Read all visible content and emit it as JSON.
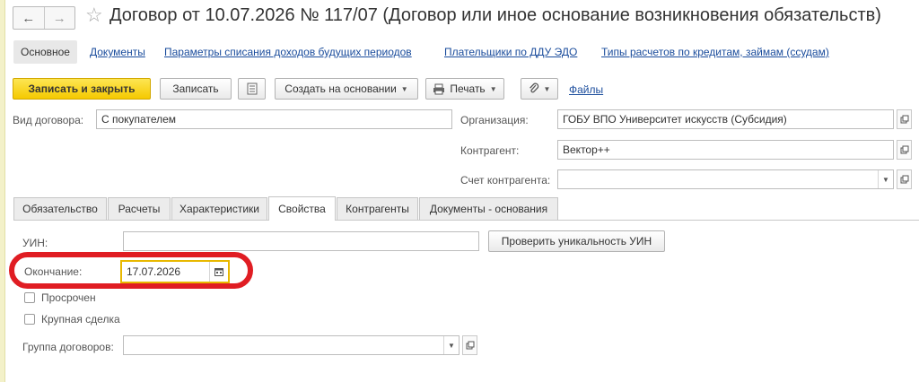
{
  "window": {
    "title": "Договор от 10.07.2026 № 117/07 (Договор или иное основание возникновения обязательств)"
  },
  "sections": [
    {
      "label": "Основное"
    },
    {
      "label": "Документы"
    },
    {
      "label": "Параметры списания доходов будущих периодов"
    },
    {
      "label": "Плательщики по ДДУ ЭДО"
    },
    {
      "label": "Типы расчетов по кредитам, займам (ссудам)"
    }
  ],
  "toolbar": {
    "save_close": "Записать и закрыть",
    "save": "Записать",
    "create_based": "Создать на основании",
    "print": "Печать",
    "files": "Файлы"
  },
  "form": {
    "contract_type_label": "Вид договора:",
    "contract_type_value": "С покупателем",
    "organization_label": "Организация:",
    "organization_value": "ГОБУ ВПО Университет искусств (Субсидия)",
    "counterparty_label": "Контрагент:",
    "counterparty_value": "Вектор++",
    "account_label": "Счет контрагента:",
    "account_value": ""
  },
  "tabs": [
    {
      "label": "Обязательство"
    },
    {
      "label": "Расчеты"
    },
    {
      "label": "Характеристики"
    },
    {
      "label": "Свойства"
    },
    {
      "label": "Контрагенты"
    },
    {
      "label": "Документы - основания"
    }
  ],
  "properties": {
    "uin_label": "УИН:",
    "uin_value": "",
    "check_uin_button": "Проверить уникальность УИН",
    "end_label": "Окончание:",
    "end_value": "17.07.2026",
    "overdue_label": "Просрочен",
    "overdue_checked": false,
    "major_deal_label": "Крупная сделка",
    "major_deal_checked": false,
    "group_label": "Группа договоров:",
    "group_value": ""
  },
  "colors": {
    "primary_button": "#f5c900",
    "link": "#1a4c9c",
    "highlight_ring": "#e01d23",
    "active_field_border": "#e8b800"
  }
}
